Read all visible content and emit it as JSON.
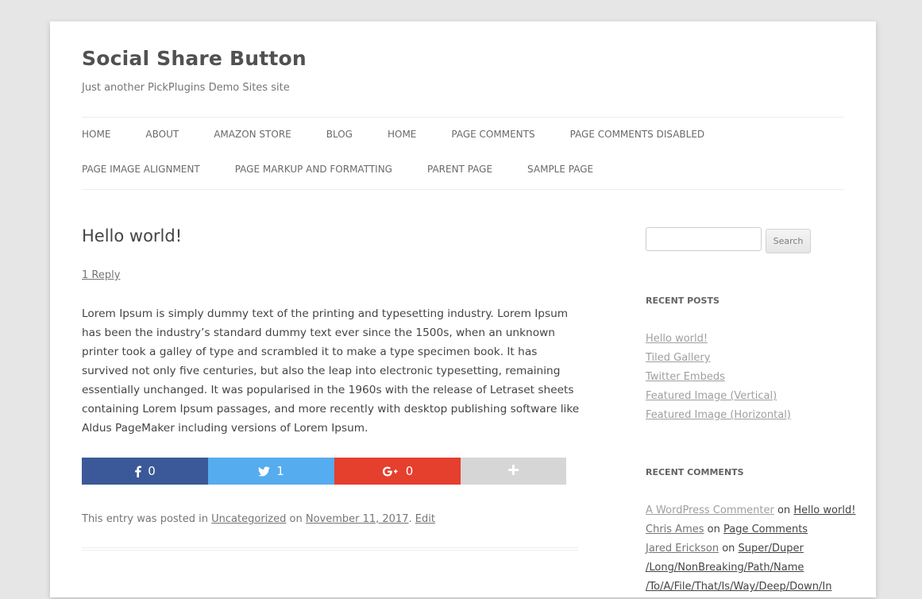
{
  "site": {
    "title": "Social Share Button",
    "description": "Just another PickPlugins Demo Sites site"
  },
  "nav": {
    "row1": [
      "HOME",
      "ABOUT",
      "AMAZON STORE",
      "BLOG",
      "HOME",
      "PAGE COMMENTS",
      "PAGE COMMENTS DISABLED"
    ],
    "row2": [
      "PAGE IMAGE ALIGNMENT",
      "PAGE MARKUP AND FORMATTING",
      "PARENT PAGE",
      "SAMPLE PAGE"
    ]
  },
  "post": {
    "title": "Hello world!",
    "reply_link": "1 Reply",
    "body": "Lorem Ipsum is simply dummy text of the printing and typesetting industry. Lorem Ipsum has been the industry’s standard dummy text ever since the 1500s, when an unknown printer took a galley of type and scrambled it to make a type specimen book. It has survived not only five centuries, but also the leap into electronic typesetting, remaining essentially unchanged. It was popularised in the 1960s with the release of Letraset sheets containing Lorem Ipsum passages, and more recently with desktop publishing software like Aldus PageMaker including versions of Lorem Ipsum.",
    "meta": {
      "prefix": "This entry was posted in",
      "category": "Uncategorized",
      "on": "on",
      "date": "November 11, 2017",
      "period": ".",
      "edit": "Edit"
    }
  },
  "share": {
    "facebook": {
      "icon": "facebook-icon",
      "count": "0",
      "color": "#3b5998"
    },
    "twitter": {
      "icon": "twitter-icon",
      "count": "1",
      "color": "#55acee"
    },
    "googleplus": {
      "icon": "google-plus-icon",
      "count": "0",
      "color": "#e53f2e"
    },
    "more": {
      "icon": "plus-icon",
      "color": "#d6d6d6"
    }
  },
  "sidebar": {
    "search": {
      "placeholder": "",
      "button_label": "Search"
    },
    "recent_posts_title": "RECENT POSTS",
    "recent_posts": [
      "Hello world!",
      "Tiled Gallery",
      "Twitter Embeds",
      "Featured Image (Vertical)",
      "Featured Image (Horizontal)"
    ],
    "recent_comments_title": "RECENT COMMENTS",
    "recent_comments": [
      {
        "author": "A WordPress Commenter",
        "on": "on",
        "post": "Hello world!"
      },
      {
        "author": "Chris Ames",
        "on": "on",
        "post": "Page Comments"
      },
      {
        "author": "Jared Erickson",
        "on": "on",
        "post": "Super/Duper"
      },
      {
        "author": "",
        "on": "",
        "post": "/Long/NonBreaking/Path/Name"
      },
      {
        "author": "",
        "on": "",
        "post": "/To/A/File/That/Is/Way/Deep/Down/In"
      }
    ]
  }
}
